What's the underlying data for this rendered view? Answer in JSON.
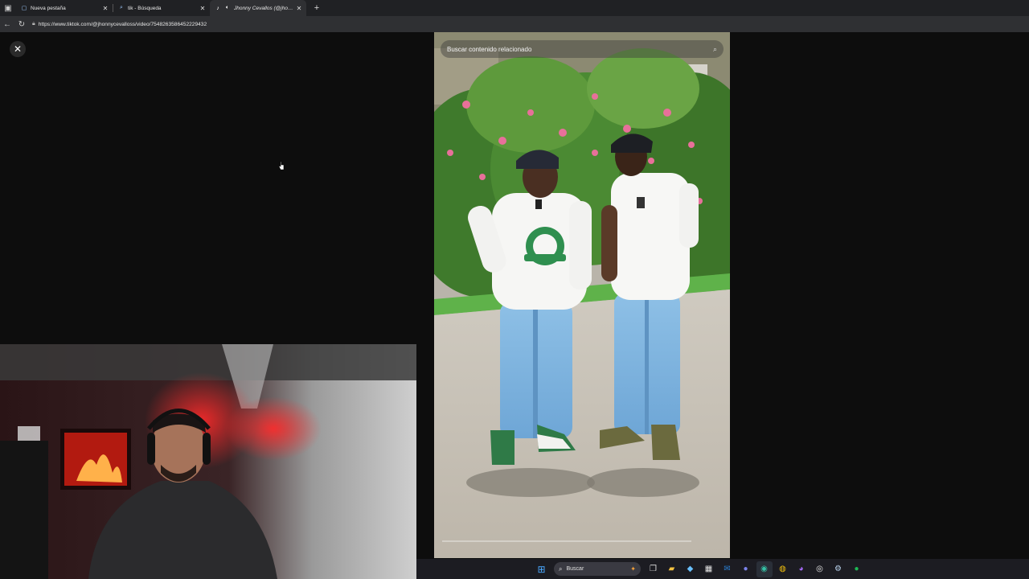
{
  "browser": {
    "tabs": [
      {
        "label": "Nueva pestaña",
        "icon": "page-icon",
        "active": false
      },
      {
        "label": "tik - Búsqueda",
        "icon": "search-icon",
        "active": false
      },
      {
        "label": "Jhonny Cevallos (@jhonnyce...",
        "icon": "tiktok-icon",
        "active": true
      }
    ],
    "url": "https://www.tiktok.com/@jhonnycevalloss/video/7548263586452229432"
  },
  "video": {
    "search_placeholder": "Buscar contenido relacionado"
  },
  "taskbar": {
    "search_label": "Buscar",
    "icons": [
      "windows-start-icon",
      "task-view-icon",
      "file-explorer-icon",
      "copilot-icon",
      "calendar-icon",
      "outlook-icon",
      "teams-icon",
      "edge-icon",
      "chrome-icon",
      "messenger-icon",
      "obs-icon",
      "steam-icon",
      "spotify-icon"
    ]
  },
  "colors": {
    "accent": "#1db954",
    "tab_bar": "#202124",
    "address_bar": "#2f3033"
  }
}
